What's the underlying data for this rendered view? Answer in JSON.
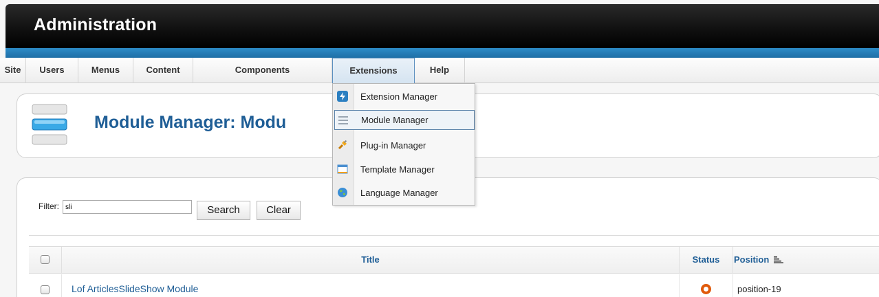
{
  "header": {
    "title": "Administration"
  },
  "menu": {
    "items": [
      {
        "label": "Site"
      },
      {
        "label": "Users"
      },
      {
        "label": "Menus"
      },
      {
        "label": "Content"
      },
      {
        "label": "Components"
      },
      {
        "label": "Extensions"
      },
      {
        "label": "Help"
      }
    ],
    "active": "Extensions"
  },
  "dropdown": {
    "items": [
      {
        "label": "Extension Manager",
        "icon": "extension-icon"
      },
      {
        "label": "Module Manager",
        "icon": "module-icon"
      },
      {
        "label": "Plug-in Manager",
        "icon": "plugin-icon"
      },
      {
        "label": "Template Manager",
        "icon": "template-icon"
      },
      {
        "label": "Language Manager",
        "icon": "language-icon"
      }
    ],
    "highlighted": "Module Manager"
  },
  "page": {
    "title": "Module Manager: Modu"
  },
  "filter": {
    "label": "Filter:",
    "value": "sli",
    "search_label": "Search",
    "clear_label": "Clear"
  },
  "table": {
    "headers": {
      "title": "Title",
      "status": "Status",
      "position": "Position"
    },
    "rows": [
      {
        "title": "Lof ArticlesSlideShow Module",
        "status": "published",
        "position": "position-19"
      }
    ]
  },
  "colors": {
    "accent": "#1f5e96",
    "status": "#e05a0b",
    "band": "#2d8cc8"
  }
}
